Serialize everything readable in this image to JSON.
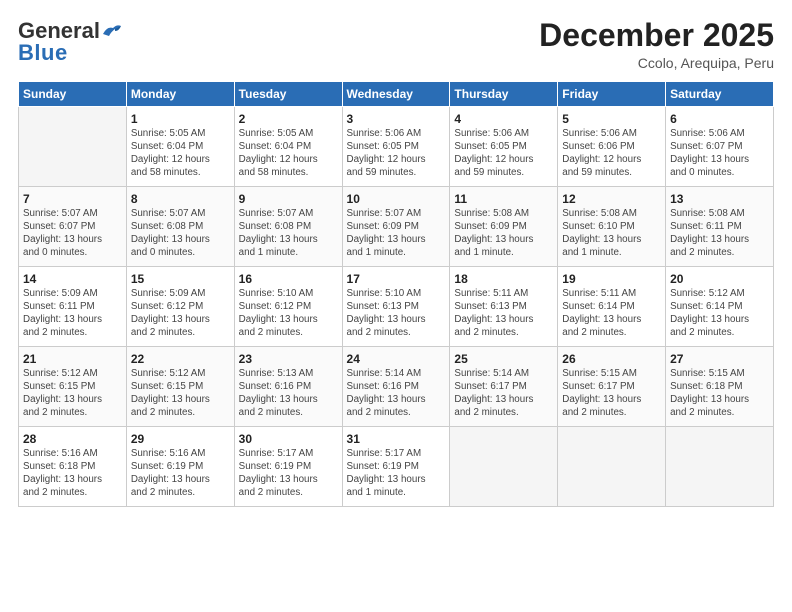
{
  "header": {
    "logo_general": "General",
    "logo_blue": "Blue",
    "month_title": "December 2025",
    "location": "Ccolo, Arequipa, Peru"
  },
  "days_of_week": [
    "Sunday",
    "Monday",
    "Tuesday",
    "Wednesday",
    "Thursday",
    "Friday",
    "Saturday"
  ],
  "weeks": [
    [
      {
        "day": "",
        "info": ""
      },
      {
        "day": "1",
        "info": "Sunrise: 5:05 AM\nSunset: 6:04 PM\nDaylight: 12 hours\nand 58 minutes."
      },
      {
        "day": "2",
        "info": "Sunrise: 5:05 AM\nSunset: 6:04 PM\nDaylight: 12 hours\nand 58 minutes."
      },
      {
        "day": "3",
        "info": "Sunrise: 5:06 AM\nSunset: 6:05 PM\nDaylight: 12 hours\nand 59 minutes."
      },
      {
        "day": "4",
        "info": "Sunrise: 5:06 AM\nSunset: 6:05 PM\nDaylight: 12 hours\nand 59 minutes."
      },
      {
        "day": "5",
        "info": "Sunrise: 5:06 AM\nSunset: 6:06 PM\nDaylight: 12 hours\nand 59 minutes."
      },
      {
        "day": "6",
        "info": "Sunrise: 5:06 AM\nSunset: 6:07 PM\nDaylight: 13 hours\nand 0 minutes."
      }
    ],
    [
      {
        "day": "7",
        "info": "Sunrise: 5:07 AM\nSunset: 6:07 PM\nDaylight: 13 hours\nand 0 minutes."
      },
      {
        "day": "8",
        "info": "Sunrise: 5:07 AM\nSunset: 6:08 PM\nDaylight: 13 hours\nand 0 minutes."
      },
      {
        "day": "9",
        "info": "Sunrise: 5:07 AM\nSunset: 6:08 PM\nDaylight: 13 hours\nand 1 minute."
      },
      {
        "day": "10",
        "info": "Sunrise: 5:07 AM\nSunset: 6:09 PM\nDaylight: 13 hours\nand 1 minute."
      },
      {
        "day": "11",
        "info": "Sunrise: 5:08 AM\nSunset: 6:09 PM\nDaylight: 13 hours\nand 1 minute."
      },
      {
        "day": "12",
        "info": "Sunrise: 5:08 AM\nSunset: 6:10 PM\nDaylight: 13 hours\nand 1 minute."
      },
      {
        "day": "13",
        "info": "Sunrise: 5:08 AM\nSunset: 6:11 PM\nDaylight: 13 hours\nand 2 minutes."
      }
    ],
    [
      {
        "day": "14",
        "info": "Sunrise: 5:09 AM\nSunset: 6:11 PM\nDaylight: 13 hours\nand 2 minutes."
      },
      {
        "day": "15",
        "info": "Sunrise: 5:09 AM\nSunset: 6:12 PM\nDaylight: 13 hours\nand 2 minutes."
      },
      {
        "day": "16",
        "info": "Sunrise: 5:10 AM\nSunset: 6:12 PM\nDaylight: 13 hours\nand 2 minutes."
      },
      {
        "day": "17",
        "info": "Sunrise: 5:10 AM\nSunset: 6:13 PM\nDaylight: 13 hours\nand 2 minutes."
      },
      {
        "day": "18",
        "info": "Sunrise: 5:11 AM\nSunset: 6:13 PM\nDaylight: 13 hours\nand 2 minutes."
      },
      {
        "day": "19",
        "info": "Sunrise: 5:11 AM\nSunset: 6:14 PM\nDaylight: 13 hours\nand 2 minutes."
      },
      {
        "day": "20",
        "info": "Sunrise: 5:12 AM\nSunset: 6:14 PM\nDaylight: 13 hours\nand 2 minutes."
      }
    ],
    [
      {
        "day": "21",
        "info": "Sunrise: 5:12 AM\nSunset: 6:15 PM\nDaylight: 13 hours\nand 2 minutes."
      },
      {
        "day": "22",
        "info": "Sunrise: 5:12 AM\nSunset: 6:15 PM\nDaylight: 13 hours\nand 2 minutes."
      },
      {
        "day": "23",
        "info": "Sunrise: 5:13 AM\nSunset: 6:16 PM\nDaylight: 13 hours\nand 2 minutes."
      },
      {
        "day": "24",
        "info": "Sunrise: 5:14 AM\nSunset: 6:16 PM\nDaylight: 13 hours\nand 2 minutes."
      },
      {
        "day": "25",
        "info": "Sunrise: 5:14 AM\nSunset: 6:17 PM\nDaylight: 13 hours\nand 2 minutes."
      },
      {
        "day": "26",
        "info": "Sunrise: 5:15 AM\nSunset: 6:17 PM\nDaylight: 13 hours\nand 2 minutes."
      },
      {
        "day": "27",
        "info": "Sunrise: 5:15 AM\nSunset: 6:18 PM\nDaylight: 13 hours\nand 2 minutes."
      }
    ],
    [
      {
        "day": "28",
        "info": "Sunrise: 5:16 AM\nSunset: 6:18 PM\nDaylight: 13 hours\nand 2 minutes."
      },
      {
        "day": "29",
        "info": "Sunrise: 5:16 AM\nSunset: 6:19 PM\nDaylight: 13 hours\nand 2 minutes."
      },
      {
        "day": "30",
        "info": "Sunrise: 5:17 AM\nSunset: 6:19 PM\nDaylight: 13 hours\nand 2 minutes."
      },
      {
        "day": "31",
        "info": "Sunrise: 5:17 AM\nSunset: 6:19 PM\nDaylight: 13 hours\nand 1 minute."
      },
      {
        "day": "",
        "info": ""
      },
      {
        "day": "",
        "info": ""
      },
      {
        "day": "",
        "info": ""
      }
    ]
  ]
}
